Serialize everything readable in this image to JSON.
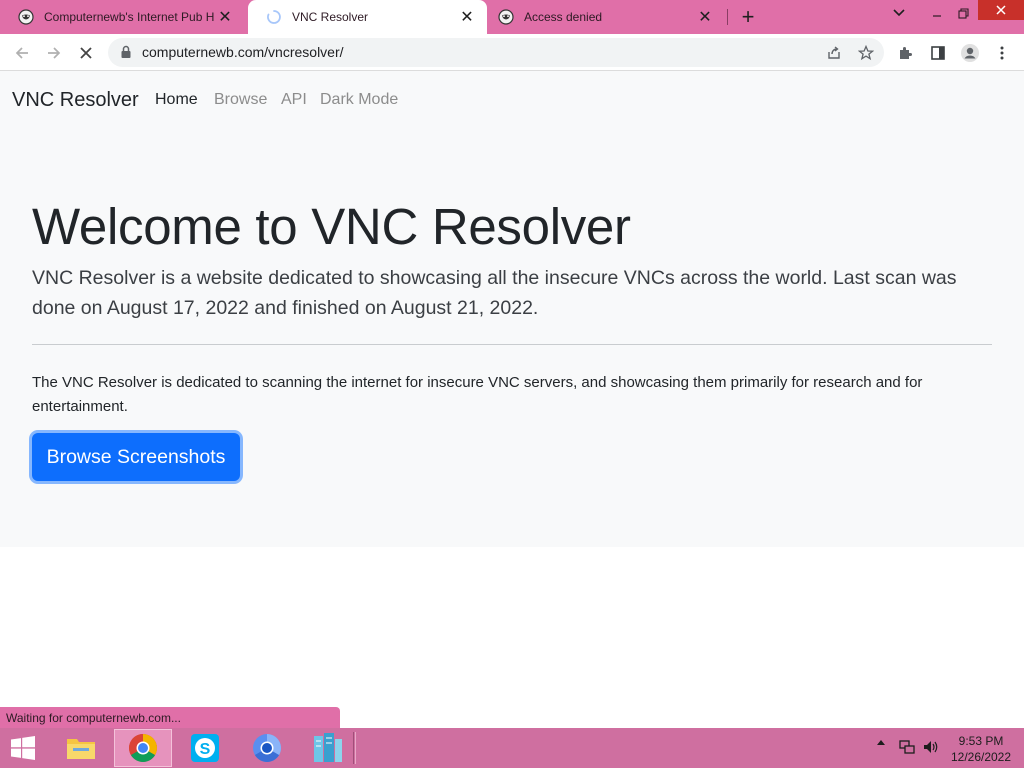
{
  "browser": {
    "tabs": [
      {
        "title": "Computernewb's Internet Pub H",
        "icon": "hacker-mask-icon",
        "active": false
      },
      {
        "title": "VNC Resolver",
        "icon": "loading-spinner-icon",
        "active": true
      },
      {
        "title": "Access denied",
        "icon": "hacker-mask-icon",
        "active": false
      }
    ],
    "url": "computernewb.com/vncresolver/",
    "status": "Waiting for computernewb.com..."
  },
  "site": {
    "brand": "VNC Resolver",
    "nav": [
      "Home",
      "Browse",
      "API",
      "Dark Mode"
    ],
    "active_nav": "Home",
    "hero": {
      "title": "Welcome to VNC Resolver",
      "lead": "VNC Resolver is a website dedicated to showcasing all the insecure VNCs across the world. Last scan was done on August 17, 2022 and finished on August 21, 2022.",
      "body": "The VNC Resolver is dedicated to scanning the internet for insecure VNC servers, and showcasing them primarily for research and for entertainment.",
      "button": "Browse Screenshots"
    }
  },
  "taskbar": {
    "apps": [
      "file-explorer-icon",
      "chrome-icon",
      "skype-icon",
      "chromium-icon",
      "server-manager-icon"
    ],
    "time": "9:53 PM",
    "date": "12/26/2022"
  },
  "colors": {
    "accent": "#e06fa8",
    "taskbar": "#cf6fa0",
    "primary_button": "#0d6efd",
    "hero_bg": "#f8f9fa"
  }
}
